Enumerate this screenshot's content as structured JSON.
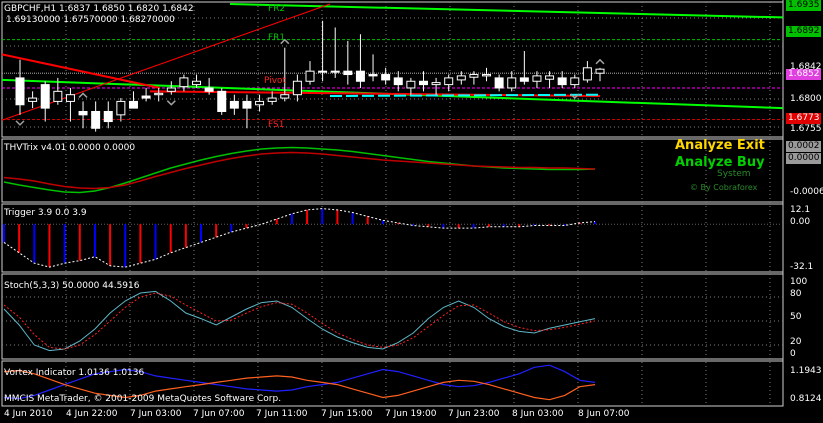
{
  "main": {
    "symbol_line": "GBPCHF,H1  1.6837 1.6850 1.6820 1.6842",
    "values_line": "1.69130000 1.67570000 1.68270000",
    "level_labels": {
      "fr2": "FR2",
      "fr1": "FR1",
      "pivot": "Pivot",
      "fs1": "FS1"
    },
    "axis_ticks": [
      "1.6842",
      "1.6800",
      "1.6755"
    ],
    "badges": [
      {
        "text": "1.6935",
        "color": "#00c000"
      },
      {
        "text": "1.6892",
        "color": "#00c000"
      },
      {
        "text": "1.6852",
        "color": "#e040e0"
      },
      {
        "text": "1.6773",
        "color": "#e00000"
      }
    ],
    "price_line_label": "1.6842"
  },
  "thv": {
    "title": "THVTrix v4.01 0.0000 0.0000",
    "analyze_exit": "Analyze Exit",
    "analyze_buy": "Analyze Buy",
    "system_text": "System",
    "credit": "© By Cobraforex",
    "axis_ticks": [
      "0.0000",
      "-0.0006"
    ],
    "badges": [
      {
        "text": "0.0002",
        "color": "#9a9a9a"
      },
      {
        "text": "0.0000",
        "color": "#9a9a9a"
      }
    ]
  },
  "trigger": {
    "title": "Trigger 3.9 0.0 3.9",
    "axis_ticks": [
      "12.1",
      "0.00",
      "-32.1"
    ]
  },
  "stoch": {
    "title": "Stoch(5,3,3) 50.0000 44.5916",
    "axis_ticks": [
      "100",
      "80",
      "50",
      "20",
      "0"
    ]
  },
  "vortex": {
    "title": "Vortex Indicator 1.0136 1.0136",
    "axis_ticks": [
      "1.1943",
      "0.8124"
    ],
    "footer": "MMCIS MetaTrader, © 2001-2009 MetaQuotes Software Corp."
  },
  "time_axis": [
    "4 Jun 2010",
    "4 Jun 22:00",
    "7 Jun 03:00",
    "7 Jun 07:00",
    "7 Jun 11:00",
    "7 Jun 15:00",
    "7 Jun 19:00",
    "7 Jun 23:00",
    "8 Jun 03:00",
    "8 Jun 07:00"
  ],
  "colors": {
    "background": "#000000",
    "grid": "#808080",
    "bull_candle": "#ffffff",
    "bear_candle": "#ffffff",
    "green": "#00ff00",
    "red": "#ff0000",
    "blue": "#0000ff",
    "yellow": "#ffd700",
    "cyan": "#00ffff"
  },
  "chart_data": {
    "type": "line",
    "candles": [
      {
        "o": 1.6835,
        "h": 1.6862,
        "l": 1.678,
        "c": 1.6795
      },
      {
        "o": 1.68,
        "h": 1.6815,
        "l": 1.679,
        "c": 1.6805
      },
      {
        "o": 1.6825,
        "h": 1.683,
        "l": 1.677,
        "c": 1.679
      },
      {
        "o": 1.68,
        "h": 1.6835,
        "l": 1.6795,
        "c": 1.6815
      },
      {
        "o": 1.68,
        "h": 1.682,
        "l": 1.677,
        "c": 1.681
      },
      {
        "o": 1.6785,
        "h": 1.68,
        "l": 1.676,
        "c": 1.678
      },
      {
        "o": 1.6785,
        "h": 1.68,
        "l": 1.6755,
        "c": 1.676
      },
      {
        "o": 1.6785,
        "h": 1.68,
        "l": 1.676,
        "c": 1.677
      },
      {
        "o": 1.678,
        "h": 1.6805,
        "l": 1.677,
        "c": 1.68
      },
      {
        "o": 1.68,
        "h": 1.6815,
        "l": 1.679,
        "c": 1.679
      },
      {
        "o": 1.6808,
        "h": 1.682,
        "l": 1.68,
        "c": 1.6805
      },
      {
        "o": 1.681,
        "h": 1.682,
        "l": 1.68,
        "c": 1.6812
      },
      {
        "o": 1.6815,
        "h": 1.683,
        "l": 1.681,
        "c": 1.682
      },
      {
        "o": 1.6822,
        "h": 1.684,
        "l": 1.6815,
        "c": 1.6835
      },
      {
        "o": 1.6825,
        "h": 1.684,
        "l": 1.682,
        "c": 1.683
      },
      {
        "o": 1.682,
        "h": 1.6835,
        "l": 1.681,
        "c": 1.6815
      },
      {
        "o": 1.6815,
        "h": 1.682,
        "l": 1.678,
        "c": 1.6785
      },
      {
        "o": 1.68,
        "h": 1.681,
        "l": 1.678,
        "c": 1.679
      },
      {
        "o": 1.68,
        "h": 1.681,
        "l": 1.676,
        "c": 1.679
      },
      {
        "o": 1.6795,
        "h": 1.681,
        "l": 1.6785,
        "c": 1.68
      },
      {
        "o": 1.68,
        "h": 1.6815,
        "l": 1.6795,
        "c": 1.6805
      },
      {
        "o": 1.6805,
        "h": 1.688,
        "l": 1.68,
        "c": 1.681
      },
      {
        "o": 1.681,
        "h": 1.684,
        "l": 1.68,
        "c": 1.683
      },
      {
        "o": 1.683,
        "h": 1.686,
        "l": 1.6825,
        "c": 1.6845
      },
      {
        "o": 1.6845,
        "h": 1.692,
        "l": 1.683,
        "c": 1.6845
      },
      {
        "o": 1.6845,
        "h": 1.691,
        "l": 1.6835,
        "c": 1.6845
      },
      {
        "o": 1.6845,
        "h": 1.689,
        "l": 1.6825,
        "c": 1.684
      },
      {
        "o": 1.6845,
        "h": 1.69,
        "l": 1.682,
        "c": 1.683
      },
      {
        "o": 1.684,
        "h": 1.687,
        "l": 1.683,
        "c": 1.6838
      },
      {
        "o": 1.684,
        "h": 1.685,
        "l": 1.6825,
        "c": 1.6832
      },
      {
        "o": 1.6835,
        "h": 1.6845,
        "l": 1.6815,
        "c": 1.6825
      },
      {
        "o": 1.682,
        "h": 1.6835,
        "l": 1.681,
        "c": 1.683
      },
      {
        "o": 1.683,
        "h": 1.6845,
        "l": 1.6815,
        "c": 1.6825
      },
      {
        "o": 1.6825,
        "h": 1.6835,
        "l": 1.681,
        "c": 1.6828
      },
      {
        "o": 1.6825,
        "h": 1.684,
        "l": 1.6815,
        "c": 1.6835
      },
      {
        "o": 1.6832,
        "h": 1.6845,
        "l": 1.6825,
        "c": 1.6838
      },
      {
        "o": 1.6836,
        "h": 1.6845,
        "l": 1.6825,
        "c": 1.684
      },
      {
        "o": 1.6838,
        "h": 1.685,
        "l": 1.683,
        "c": 1.684
      },
      {
        "o": 1.6835,
        "h": 1.684,
        "l": 1.6815,
        "c": 1.682
      },
      {
        "o": 1.682,
        "h": 1.6845,
        "l": 1.6815,
        "c": 1.6835
      },
      {
        "o": 1.6835,
        "h": 1.6875,
        "l": 1.6825,
        "c": 1.683
      },
      {
        "o": 1.683,
        "h": 1.6845,
        "l": 1.682,
        "c": 1.6838
      },
      {
        "o": 1.6833,
        "h": 1.6845,
        "l": 1.682,
        "c": 1.6838
      },
      {
        "o": 1.6835,
        "h": 1.6845,
        "l": 1.682,
        "c": 1.6825
      },
      {
        "o": 1.6825,
        "h": 1.684,
        "l": 1.682,
        "c": 1.6835
      },
      {
        "o": 1.6832,
        "h": 1.686,
        "l": 1.6828,
        "c": 1.685
      },
      {
        "o": 1.6842,
        "h": 1.685,
        "l": 1.683,
        "c": 1.6848
      }
    ],
    "price_range": [
      1.675,
      1.6945
    ],
    "levels": {
      "fr2": 1.6935,
      "fr1": 1.6892,
      "pivot": 1.682,
      "fs1": 1.6773
    },
    "thv_trix": {
      "series": [
        {
          "name": "green",
          "values": [
            -0.00024,
            -0.0003,
            -0.00035,
            -0.0004,
            -0.00044,
            -0.00045,
            -0.00042,
            -0.00035,
            -0.00026,
            -0.00016,
            -6e-05,
            4e-05,
            0.00012,
            0.0002,
            0.00027,
            0.00033,
            0.00038,
            0.00042,
            0.00044,
            0.00045,
            0.00044,
            0.00042,
            0.0004,
            0.00037,
            0.00033,
            0.00029,
            0.00025,
            0.00021,
            0.00017,
            0.00014,
            0.00011,
            8e-05,
            6e-05,
            4e-05,
            3e-05,
            2e-05,
            1e-05,
            1e-05,
            1e-05,
            2e-05
          ]
        },
        {
          "name": "red",
          "values": [
            -0.00015,
            -0.00018,
            -0.00022,
            -0.00028,
            -0.00033,
            -0.00036,
            -0.00037,
            -0.00035,
            -0.0003,
            -0.00022,
            -0.00013,
            -5e-05,
            3e-05,
            0.0001,
            0.00017,
            0.00023,
            0.00028,
            0.00032,
            0.00034,
            0.00035,
            0.00034,
            0.00032,
            0.00029,
            0.00026,
            0.00023,
            0.0002,
            0.00018,
            0.00016,
            0.00014,
            0.00012,
            0.0001,
            8e-05,
            7e-05,
            6e-05,
            5e-05,
            5e-05,
            4e-05,
            4e-05,
            3e-05,
            2e-05
          ]
        }
      ]
    },
    "trigger": [
      -14,
      -22,
      -30,
      -33,
      -30,
      -28,
      -25,
      -32,
      -33,
      -30,
      -27,
      -22,
      -18,
      -14,
      -10,
      -6,
      -3,
      0,
      4,
      8,
      11,
      12,
      11,
      9,
      6,
      3,
      1,
      -1,
      -2,
      -3,
      -3,
      -3,
      -2,
      -2,
      -2,
      -1,
      -1,
      -1,
      1,
      2
    ],
    "stoch": {
      "main": [
        60,
        40,
        15,
        8,
        10,
        20,
        35,
        55,
        70,
        80,
        82,
        70,
        55,
        48,
        40,
        50,
        60,
        68,
        70,
        62,
        48,
        35,
        25,
        18,
        12,
        10,
        18,
        30,
        48,
        62,
        70,
        62,
        48,
        38,
        32,
        30,
        36,
        40,
        44,
        48
      ],
      "signal": [
        65,
        50,
        28,
        12,
        10,
        15,
        28,
        45,
        62,
        75,
        80,
        76,
        65,
        55,
        45,
        46,
        55,
        63,
        68,
        66,
        55,
        42,
        30,
        22,
        15,
        12,
        15,
        24,
        38,
        52,
        64,
        65,
        55,
        44,
        37,
        33,
        34,
        37,
        41,
        45
      ]
    },
    "vortex": {
      "series": [
        {
          "name": "blue",
          "values": [
            0.88,
            0.87,
            0.9,
            0.95,
            1.0,
            1.05,
            1.1,
            1.12,
            1.14,
            1.12,
            1.08,
            1.06,
            1.04,
            1.02,
            1.0,
            0.98,
            0.96,
            0.95,
            0.94,
            0.95,
            0.98,
            1.0,
            1.02,
            1.06,
            1.1,
            1.14,
            1.12,
            1.08,
            1.04,
            1.0,
            0.98,
            0.99,
            1.02,
            1.06,
            1.1,
            1.16,
            1.18,
            1.12,
            1.04,
            1.02
          ]
        },
        {
          "name": "orange",
          "values": [
            1.12,
            1.13,
            1.1,
            1.05,
            1.0,
            0.96,
            0.92,
            0.9,
            0.88,
            0.9,
            0.94,
            0.96,
            0.98,
            1.0,
            1.02,
            1.04,
            1.06,
            1.07,
            1.08,
            1.07,
            1.04,
            1.02,
            1.0,
            0.96,
            0.92,
            0.88,
            0.9,
            0.94,
            0.98,
            1.02,
            1.04,
            1.03,
            1.0,
            0.96,
            0.92,
            0.88,
            0.86,
            0.9,
            0.98,
            1.0
          ]
        }
      ]
    }
  }
}
